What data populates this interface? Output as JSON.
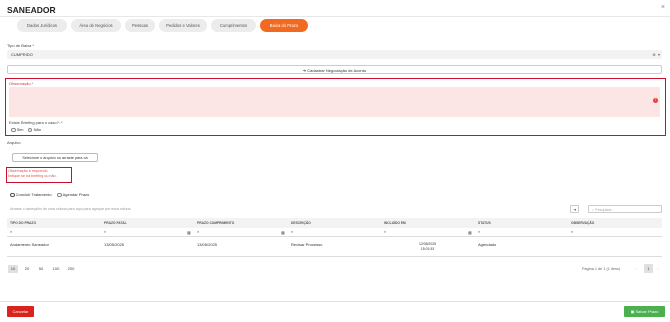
{
  "app": {
    "title": "SANEADOR",
    "close": "×"
  },
  "tabs": [
    {
      "label": "Dados Jurídicos"
    },
    {
      "label": "Área de Negócios"
    },
    {
      "label": "Pessoas"
    },
    {
      "label": "Pedidos e Valores"
    },
    {
      "label": "Cumprimentos"
    },
    {
      "label": "Baixa do Prazo"
    }
  ],
  "form": {
    "tipo_baixa_label": "Tipo de Baixa *",
    "tipo_baixa_value": "CUMPRIDO",
    "cadastrar_negociacao": "Cadastrar Negociação de Acordo",
    "observacao_label": "Observação *",
    "briefing_label": "Existe Briefing para o caso?: *",
    "sim": "Sim",
    "nao": "Não",
    "arquivo_label": "Arquivo",
    "upload_button": "Selecione o arquivo ou arraste para cá",
    "error_line1": "Observação é requerido",
    "error_line2": "Indique se há briefing ou não.",
    "concluir": "Concluir Tratamento",
    "agendar": "Agendar Prazo"
  },
  "grid": {
    "group_hint": "Arraste o cabeçalho de uma coluna para aqui para agrupar por essa coluna",
    "search_placeholder": "Pesquisar...",
    "headers": [
      "TIPO DO PRAZO",
      "PRAZO FATAL",
      "PRAZO CUMPRIMENTO",
      "DESCRIÇÃO",
      "INCLUÍDO EM",
      "STATUS",
      "OBSERVAÇÃO"
    ],
    "row": {
      "tipo": "Andamento Saneador",
      "fatal": "13/05/2025",
      "cumprimento": "13/05/2025",
      "descricao": "Revisar Processo",
      "incluido_date": "12/05/2025",
      "incluido_time": "15:01:53",
      "status": "Agendado",
      "observacao": ""
    },
    "page_sizes": [
      "10",
      "20",
      "50",
      "100",
      "200"
    ],
    "page_info": "Página 1 de 1 (1 itens)",
    "current_page": "1",
    "prev": "‹",
    "next": "›"
  },
  "footer": {
    "cancel": "Cancelar",
    "save": "Salvar Prazo"
  },
  "colors": {
    "accent": "#f26a21",
    "error": "#c8102e",
    "save": "#4caf50",
    "cancel": "#d9231d"
  }
}
